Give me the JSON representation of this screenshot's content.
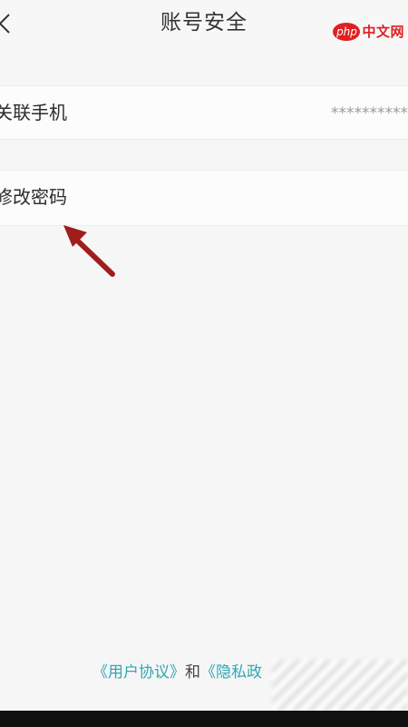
{
  "header": {
    "title": "账号安全",
    "back_icon": "chevron-left-icon"
  },
  "watermark": {
    "badge": "php",
    "text": "中文网"
  },
  "rows": [
    {
      "label": "关联手机",
      "value": "**********"
    },
    {
      "label": "修改密码"
    }
  ],
  "footer": {
    "user_agreement": "《用户协议》",
    "and": "和",
    "privacy_policy_partial": "《隐私政"
  },
  "colors": {
    "background": "#f6f6f6",
    "link": "#2fa7b6",
    "watermark": "#e02020",
    "arrow": "#a11d1d"
  }
}
